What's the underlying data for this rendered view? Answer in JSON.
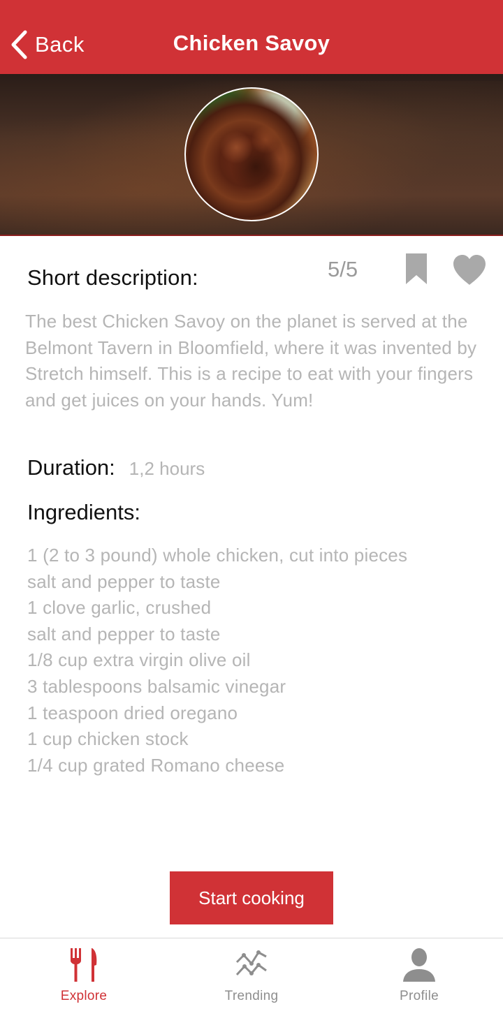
{
  "nav": {
    "back_label": "Back",
    "title": "Chicken Savoy"
  },
  "recipe": {
    "description_heading": "Short description:",
    "rating": "5/5",
    "description": "The best Chicken Savoy on the planet is served at the Belmont Tavern in Bloomfield, where it was invented by Stretch himself. This is a recipe to eat with your fingers and get juices on your hands. Yum!",
    "duration_label": "Duration:",
    "duration_value": "1,2 hours",
    "ingredients_heading": "Ingredients:",
    "ingredients": [
      "1 (2 to 3 pound) whole chicken, cut into pieces",
      "salt and pepper to taste",
      "1 clove garlic, crushed",
      "salt and pepper to taste",
      "1/8 cup extra virgin olive oil",
      "3 tablespoons balsamic vinegar",
      "1 teaspoon dried oregano",
      "1 cup chicken stock",
      "1/4 cup grated Romano cheese"
    ],
    "start_button_label": "Start cooking"
  },
  "tabs": [
    {
      "label": "Explore",
      "icon": "fork-knife-icon",
      "active": true
    },
    {
      "label": "Trending",
      "icon": "trending-chart-icon",
      "active": false
    },
    {
      "label": "Profile",
      "icon": "person-icon",
      "active": false
    }
  ],
  "colors": {
    "brand_red": "#d03236",
    "muted_text": "#b5b5b5",
    "icon_gray": "#a9a9a9",
    "inactive_tab": "#8e8e8e"
  }
}
